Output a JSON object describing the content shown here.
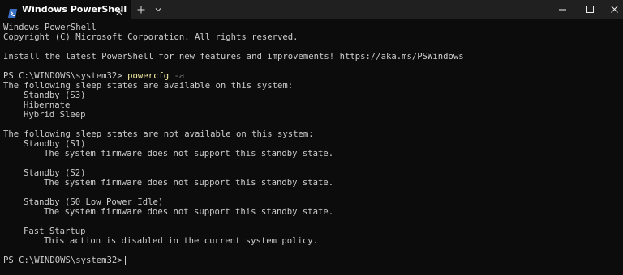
{
  "window": {
    "tab_title": "Windows PowerShell",
    "icons": {
      "tab": "powershell-icon",
      "tab_close": "close-icon",
      "new_tab": "plus-icon",
      "dropdown": "chevron-down-icon",
      "minimize": "minimize-icon",
      "maximize": "maximize-icon",
      "close": "close-icon"
    }
  },
  "colors": {
    "background": "#0c0c0c",
    "titlebar": "#202020",
    "text": "#cccccc",
    "command": "#f9f1a5",
    "parameter": "#767676"
  },
  "terminal": {
    "header_line_1": "Windows PowerShell",
    "header_line_2": "Copyright (C) Microsoft Corporation. All rights reserved.",
    "install_hint": "Install the latest PowerShell for new features and improvements! https://aka.ms/PSWindows",
    "prompt_1": "PS C:\\WINDOWS\\system32>",
    "command": "powercfg",
    "command_arg": "-a",
    "available_header": "The following sleep states are available on this system:",
    "available_states": [
      "Standby (S3)",
      "Hibernate",
      "Hybrid Sleep"
    ],
    "unavailable_header": "The following sleep states are not available on this system:",
    "unavailable_states": [
      {
        "name": "Standby (S1)",
        "reason": "The system firmware does not support this standby state."
      },
      {
        "name": "Standby (S2)",
        "reason": "The system firmware does not support this standby state."
      },
      {
        "name": "Standby (S0 Low Power Idle)",
        "reason": "The system firmware does not support this standby state."
      },
      {
        "name": "Fast Startup",
        "reason": "This action is disabled in the current system policy."
      }
    ],
    "prompt_2": "PS C:\\WINDOWS\\system32>"
  }
}
